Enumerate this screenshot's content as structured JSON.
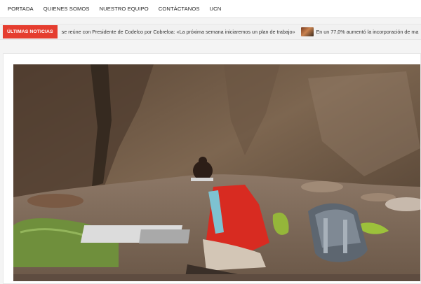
{
  "nav": {
    "items": [
      {
        "label": "PORTADA"
      },
      {
        "label": "QUIENES SOMOS"
      },
      {
        "label": "NUESTRO EQUIPO"
      },
      {
        "label": "CONTÁCTANOS"
      },
      {
        "label": "UCN"
      }
    ]
  },
  "ticker": {
    "label": "ÚLTIMAS NOTICIAS",
    "items": [
      {
        "text": "se reúne con Presidente de Codelco por Cobreloa: «La próxima semana iniciaremos un plan de trabajo»"
      },
      {
        "text": "En un 77,0% aumentó la incorporación de ma"
      }
    ]
  },
  "colors": {
    "accent": "#e53d2f",
    "nav_bg": "#ffffff",
    "ticker_bg": "#f1f1f1"
  },
  "article": {
    "image_icon": "photo-field-geologist"
  }
}
